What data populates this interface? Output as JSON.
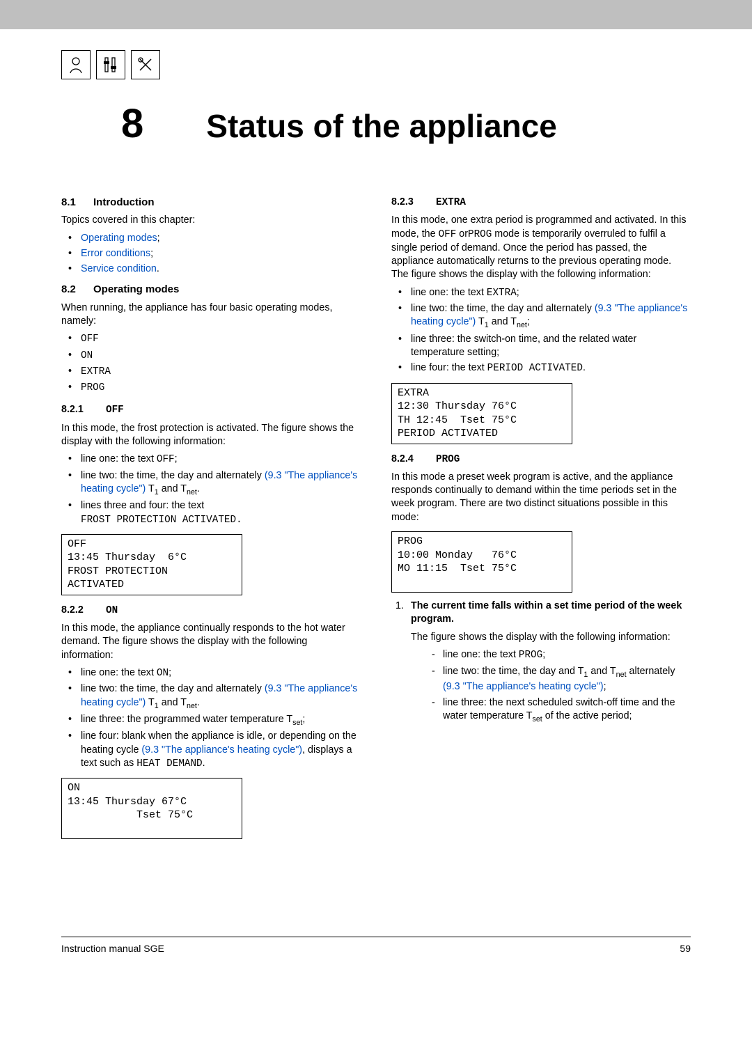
{
  "chapter": {
    "number": "8",
    "title": "Status of the appliance"
  },
  "left": {
    "s81": {
      "num": "8.1",
      "title": "Introduction",
      "intro": "Topics covered in this chapter:",
      "items": [
        "Operating modes",
        "Error conditions",
        "Service condition"
      ]
    },
    "s82": {
      "num": "8.2",
      "title": "Operating modes",
      "intro": "When running, the appliance has four basic operating modes, namely:",
      "modes": [
        "OFF",
        "ON",
        "EXTRA",
        "PROG"
      ]
    },
    "s821": {
      "num": "8.2.1",
      "title": "OFF",
      "intro": "In this mode, the frost protection is activated. The figure shows the display with the following information:",
      "b1a": "line one: the text ",
      "b1b": "OFF",
      "b1c": ";",
      "b2a": "line two: the time, the day and alternately ",
      "b2link": "(9.3 \"The appliance's heating cycle\")",
      "b2b": " T",
      "b2c": " and T",
      "b2d": ".",
      "b3a": "lines three and four: the text",
      "b3b": "FROST PROTECTION ACTIVATED.",
      "lcd": "OFF\n13:45 Thursday  6°C\nFROST PROTECTION\nACTIVATED"
    },
    "s822": {
      "num": "8.2.2",
      "title": "ON",
      "intro": "In this mode, the appliance continually responds to the hot water demand. The figure shows the display with the following information:",
      "b1a": "line one: the text ",
      "b1b": "ON",
      "b1c": ";",
      "b2a": "line two: the time, the day and alternately ",
      "b2link": "(9.3 \"The appliance's heating cycle\")",
      "b2b": " T",
      "b2c": " and T",
      "b2d": ".",
      "b3a": "line three: the programmed water temperature T",
      "b3b": ";",
      "b4a": "line four: blank when the appliance is idle, or depending on the heating cycle ",
      "b4link": "(9.3 \"The appliance's heating cycle\")",
      "b4b": ", displays a text such as ",
      "b4c": "HEAT DEMAND",
      "b4d": ".",
      "lcd": "ON\n13:45 Thursday 67°C\n           Tset 75°C\n "
    }
  },
  "right": {
    "s823": {
      "num": "8.2.3",
      "title": "EXTRA",
      "intro1": "In this mode, one extra period is programmed and activated. In this mode, the ",
      "intro2": "OFF",
      "intro3": " or",
      "intro4": "PROG",
      "intro5": " mode is temporarily overruled to fulfil a single period of demand. Once the period has passed, the appliance automatically returns to the previous operating mode. The figure shows the display with the following information:",
      "b1a": "line one: the text ",
      "b1b": "EXTRA",
      "b1c": ";",
      "b2a": "line two: the time, the day and alternately ",
      "b2link": "(9.3 \"The appliance's heating cycle\")",
      "b2b": " T",
      "b2c": " and T",
      "b2d": ";",
      "b3": "line three: the switch-on time, and the related water temperature setting;",
      "b4a": "line four: the text ",
      "b4b": "PERIOD ACTIVATED",
      "b4c": ".",
      "lcd": "EXTRA\n12:30 Thursday 76°C\nTH 12:45  Tset 75°C\nPERIOD ACTIVATED"
    },
    "s824": {
      "num": "8.2.4",
      "title": "PROG",
      "intro": "In this mode a preset week program is active, and the appliance responds continually to demand within the time periods set in the week program. There are two distinct situations possible in this mode:",
      "lcd": "PROG\n10:00 Monday   76°C\nMO 11:15  Tset 75°C\n ",
      "ol1": "The current time falls within a set time period of the week program.",
      "ol1desc": "The figure shows the display with the following information:",
      "d1a": "line one: the text ",
      "d1b": "PROG",
      "d1c": ";",
      "d2a": "line two: the time, the day and T",
      "d2b": " and T",
      "d2c": " alternately ",
      "d2link": "(9.3 \"The appliance's heating cycle\")",
      "d2d": ";",
      "d3a": "line three: the next scheduled switch-off time and the water temperature T",
      "d3b": " of the active period;"
    }
  },
  "footer": {
    "left": "Instruction manual SGE",
    "right": "59"
  }
}
